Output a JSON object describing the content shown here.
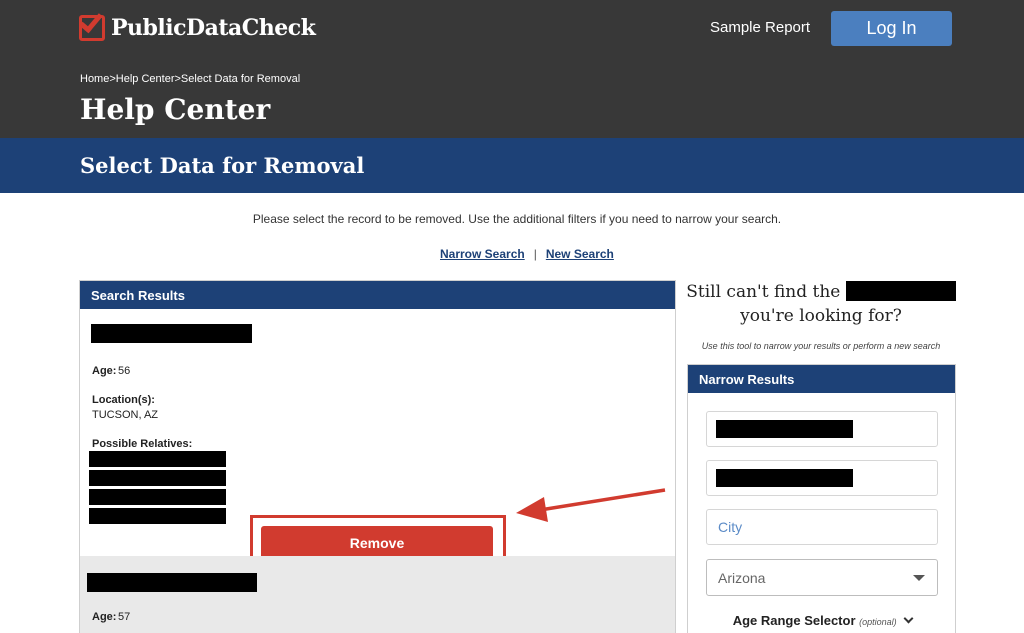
{
  "header": {
    "logo_text": "PublicDataCheck",
    "sample_report": "Sample Report",
    "login": "Log In",
    "breadcrumb": [
      "Home",
      "Help Center",
      "Select Data for Removal"
    ],
    "breadcrumb_sep": ">",
    "title": "Help Center"
  },
  "band": {
    "title": "Select Data for Removal"
  },
  "main": {
    "instructions": "Please select the record to be removed. Use the additional filters if you need to narrow your search.",
    "narrow_search_link": "Narrow Search",
    "link_separator": "|",
    "new_search_link": "New Search"
  },
  "results": {
    "header": "Search Results",
    "records": [
      {
        "age_label": "Age:",
        "age": "56",
        "location_label": "Location(s):",
        "location": "TUCSON, AZ",
        "relatives_label": "Possible Relatives:",
        "remove_label": "Remove"
      },
      {
        "age_label": "Age:",
        "age": "57"
      }
    ]
  },
  "sidebar": {
    "still_line1": "Still can't find the",
    "still_line2": "you're looking for?",
    "tool_note": "Use this tool to narrow your results or perform a new search",
    "narrow_header": "Narrow Results",
    "city_placeholder": "City",
    "state_value": "Arizona",
    "age_range_label": "Age Range Selector",
    "age_range_optional": "(optional)"
  },
  "colors": {
    "header_bg": "#383838",
    "band_bg": "#1d4177",
    "accent_red": "#d13b2f",
    "login_blue": "#4b7fbf"
  },
  "icons": [
    "logo-checkbox-icon",
    "dropdown-caret-icon",
    "chevron-down-icon",
    "annotation-arrow-icon"
  ]
}
